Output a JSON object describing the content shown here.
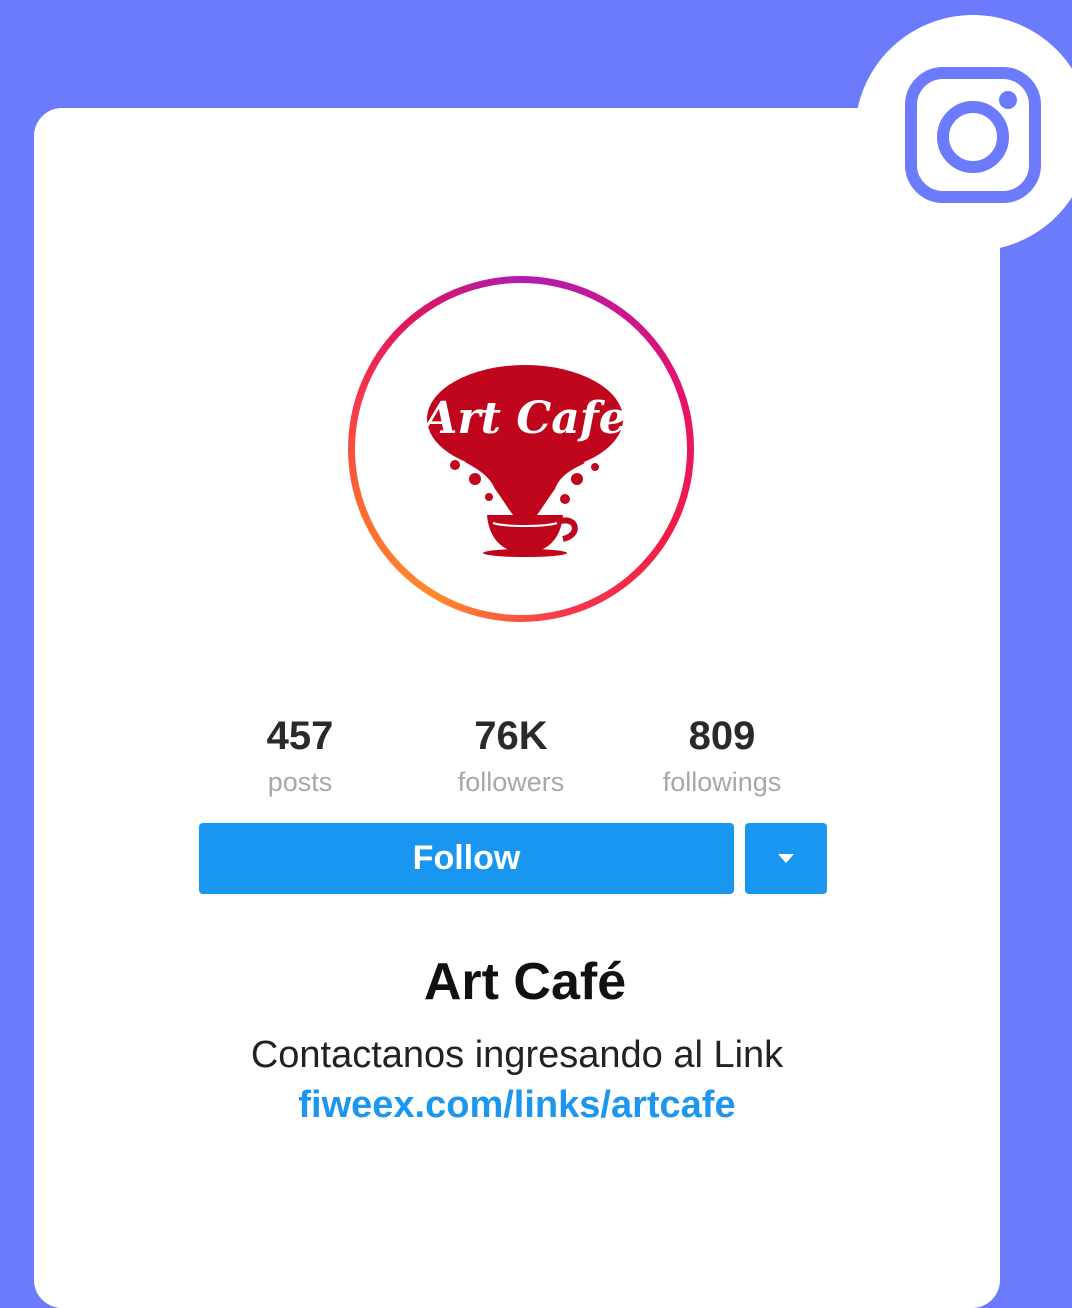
{
  "colors": {
    "background": "#6b7bfb",
    "card": "#ffffff",
    "instagram_icon": "#6b7bfb",
    "button": "#1996f0",
    "link": "#1c96ee",
    "logo_red": "#c0061c"
  },
  "badge": {
    "icon": "instagram-icon"
  },
  "avatar": {
    "logo_text": "Art Cafe",
    "icon": "coffee-cup-splash-logo"
  },
  "stats": [
    {
      "value": "457",
      "label": "posts"
    },
    {
      "value": "76K",
      "label": "followers"
    },
    {
      "value": "809",
      "label": "followings"
    }
  ],
  "actions": {
    "follow_label": "Follow",
    "dropdown_icon": "caret-down-icon"
  },
  "profile": {
    "name": "Art Café",
    "bio": "Contactanos ingresando al Link",
    "link": "fiweex.com/links/artcafe"
  }
}
